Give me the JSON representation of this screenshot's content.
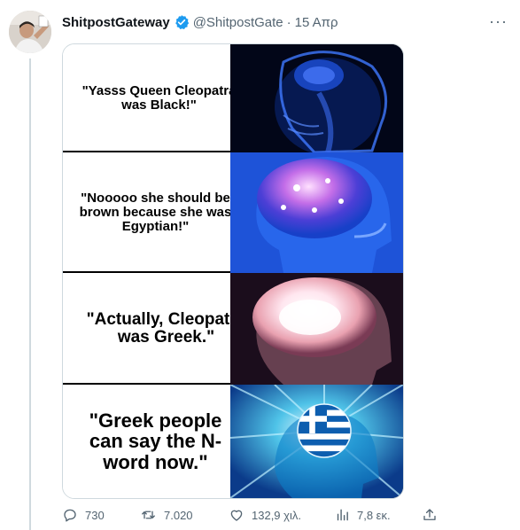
{
  "tweet": {
    "author_name": "ShitpostGateway",
    "author_handle": "@ShitpostGate",
    "separator": "·",
    "date": "15 Απρ",
    "more_label": "···"
  },
  "meme": {
    "panels": [
      {
        "text": "\"Yasss Queen Cleopatra was Black!\""
      },
      {
        "text": "\"Nooooo she should be brown because she was Egyptian!\""
      },
      {
        "text": "\"Actually, Cleopatra was Greek.\""
      },
      {
        "text": "\"Greek people can say the N-word now.\""
      }
    ]
  },
  "actions": {
    "replies": "730",
    "retweets": "7.020",
    "likes": "132,9 χιλ.",
    "views": "7,8 εκ."
  },
  "colors": {
    "verified": "#1d9bf0",
    "secondary_text": "#536471",
    "border": "#cfd9de"
  }
}
